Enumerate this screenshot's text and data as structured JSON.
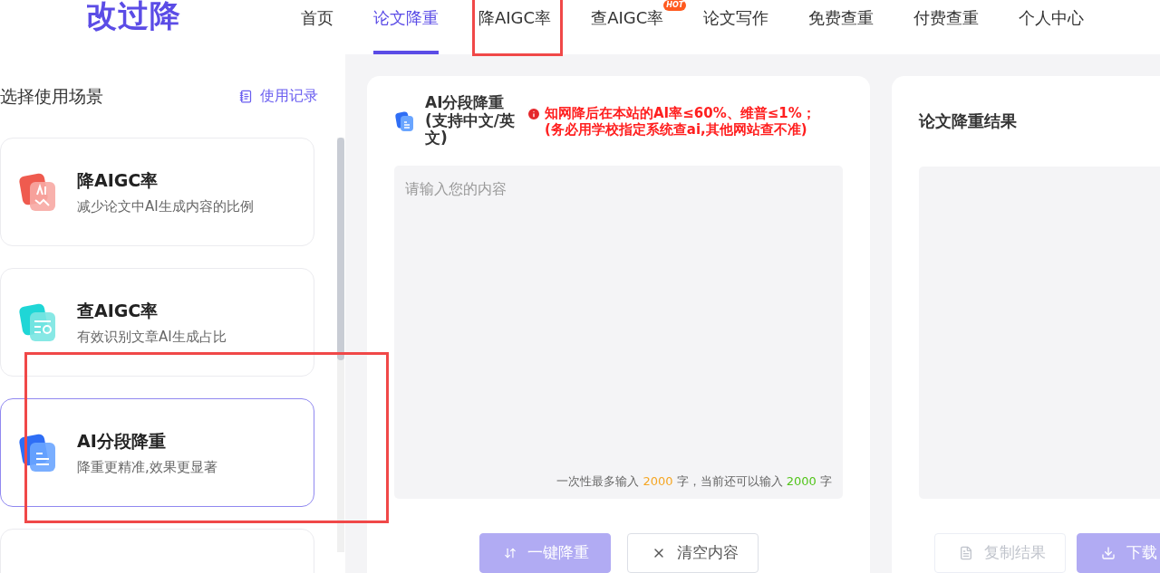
{
  "logo": "改过降",
  "nav": [
    {
      "label": "首页",
      "selected": false
    },
    {
      "label": "论文降重",
      "selected": true
    },
    {
      "label": "降AIGC率",
      "selected": false
    },
    {
      "label": "查AIGC率",
      "selected": false,
      "badge": "HOT"
    },
    {
      "label": "论文写作",
      "selected": false
    },
    {
      "label": "免费查重",
      "selected": false
    },
    {
      "label": "付费查重",
      "selected": false
    },
    {
      "label": "个人中心",
      "selected": false
    }
  ],
  "sidebar": {
    "title": "选择使用场景",
    "history_link": "使用记录",
    "scenarios": [
      {
        "kind": "reduce",
        "title": "降AIGC率",
        "subtitle": "减少论文中AI生成内容的比例",
        "selected": false
      },
      {
        "kind": "check",
        "title": "查AIGC率",
        "subtitle": "有效识别文章AI生成占比",
        "selected": false
      },
      {
        "kind": "segment",
        "title": "AI分段降重",
        "subtitle": "降重更精准,效果更显著",
        "selected": true
      },
      {
        "kind": "blank",
        "selected": false
      }
    ]
  },
  "input_panel": {
    "title": "AI分段降重(支持中文/英文)",
    "notice_line_1": "知网降后在本站的AI率≤60%、维普≤1%；",
    "notice_line_2": "(务必用学校指定系统查ai,其他网站查不准)",
    "placeholder": "请输入您的内容",
    "counter": {
      "prefix": "一次性最多输入",
      "max": "2000",
      "middle": "字，当前还可以输入",
      "remaining": "2000",
      "suffix": "字"
    },
    "buttons": [
      {
        "kind": "primary",
        "label": "一键降重",
        "disabled": true
      },
      {
        "kind": "outline",
        "label": "清空内容",
        "disabled": false
      }
    ]
  },
  "result_panel": {
    "title": "论文降重结果",
    "buttons": [
      {
        "kind": "outline",
        "label": "复制结果",
        "disabled": true
      },
      {
        "kind": "primary",
        "label": "下载",
        "disabled": true
      }
    ]
  }
}
